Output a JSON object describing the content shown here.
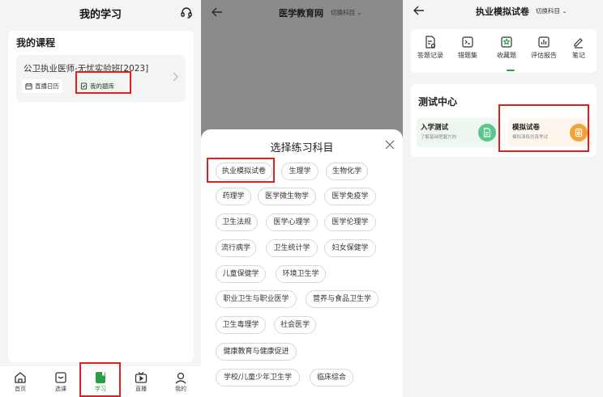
{
  "screen1": {
    "title": "我的学习",
    "card_title": "我的课程",
    "course_title": "公卫执业医师-无忧实验班[2023]",
    "chip_live": "直播日历",
    "chip_bank": "我的题库",
    "nav": [
      {
        "label": "首页",
        "icon": "home-icon"
      },
      {
        "label": "选课",
        "icon": "select-course-icon"
      },
      {
        "label": "学习",
        "icon": "study-icon"
      },
      {
        "label": "直播",
        "icon": "live-icon"
      },
      {
        "label": "我的",
        "icon": "profile-icon"
      }
    ],
    "active_color": "#2aa044"
  },
  "screen2": {
    "header_title": "医学教育网",
    "header_switch": "切换科目",
    "sheet_title": "选择练习科目",
    "subjects": [
      "执业模拟试卷",
      "生理学",
      "生物化学",
      "药理学",
      "医学微生物学",
      "医学免疫学",
      "卫生法规",
      "医学心理学",
      "医学伦理学",
      "流行病学",
      "卫生统计学",
      "妇女保健学",
      "儿童保健学",
      "环境卫生学",
      "职业卫生与职业医学",
      "营养与食品卫生学",
      "卫生毒理学",
      "社会医学",
      "健康教育与健康促进",
      "学校/儿童少年卫生学",
      "临床综合"
    ]
  },
  "screen3": {
    "header_title": "执业模拟试卷",
    "header_switch": "切换科目",
    "tools": [
      {
        "label": "答题记录",
        "icon": "answer-record-icon"
      },
      {
        "label": "错题集",
        "icon": "wrong-questions-icon"
      },
      {
        "label": "收藏题",
        "icon": "favorite-questions-icon"
      },
      {
        "label": "评估报告",
        "icon": "report-icon"
      },
      {
        "label": "笔记",
        "icon": "notes-icon"
      }
    ],
    "section_title": "测试中心",
    "cards": [
      {
        "name": "入学测试",
        "sub": "了解基础把握方向",
        "color": "#5cc78a"
      },
      {
        "name": "模拟试卷",
        "sub": "模拟演练仿真考试",
        "color": "#f2a33a"
      }
    ]
  },
  "colors": {
    "accent_green": "#2aa044",
    "highlight_red": "#e0201e"
  }
}
